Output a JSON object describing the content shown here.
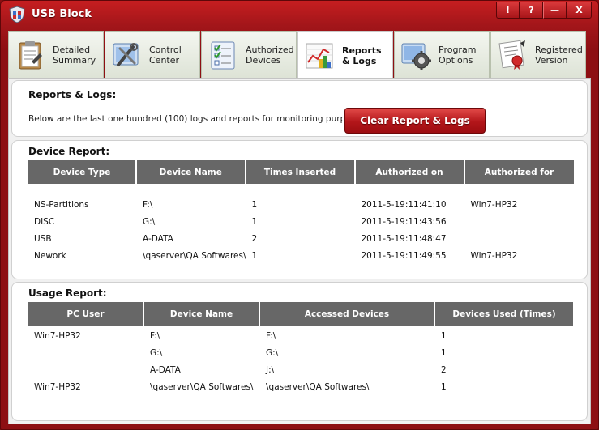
{
  "window": {
    "title": "USB Block"
  },
  "window_controls": {
    "alert": "!",
    "help": "?",
    "minimize": "—",
    "close": "X"
  },
  "tabs": [
    {
      "label": "Detailed\nSummary",
      "icon": "clipboard-icon"
    },
    {
      "label": "Control\nCenter",
      "icon": "tools-icon"
    },
    {
      "label": "Authorized\nDevices",
      "icon": "checklist-icon"
    },
    {
      "label": "Reports\n& Logs",
      "icon": "chart-icon",
      "active": true
    },
    {
      "label": "Program\nOptions",
      "icon": "gear-icon"
    },
    {
      "label": "Registered\nVersion",
      "icon": "certificate-icon"
    }
  ],
  "reports": {
    "title": "Reports & Logs:",
    "description": "Below are the last one hundred (100) logs and reports for monitoring purpose.",
    "clear_button": "Clear Report & Logs"
  },
  "device_report": {
    "title": "Device Report:",
    "columns": [
      "Device Type",
      "Device Name",
      "Times Inserted",
      "Authorized on",
      "Authorized for"
    ],
    "rows": [
      [
        "NS-Partitions",
        "F:\\",
        "1",
        "2011-5-19:11:41:10",
        "Win7-HP32"
      ],
      [
        "DISC",
        "G:\\",
        "1",
        "2011-5-19:11:43:56",
        ""
      ],
      [
        "USB",
        "A-DATA",
        "2",
        "2011-5-19:11:48:47",
        ""
      ],
      [
        "Nework",
        "\\qaserver\\QA Softwares\\",
        "1",
        "2011-5-19:11:49:55",
        "Win7-HP32"
      ]
    ]
  },
  "usage_report": {
    "title": "Usage Report:",
    "columns": [
      "PC User",
      "Device Name",
      "Accessed Devices",
      "Devices Used (Times)"
    ],
    "rows": [
      [
        "Win7-HP32",
        "F:\\",
        "F:\\",
        "1"
      ],
      [
        "",
        "G:\\",
        "G:\\",
        "1"
      ],
      [
        "",
        "A-DATA",
        "J:\\",
        "2"
      ],
      [
        "Win7-HP32",
        "\\qaserver\\QA Softwares\\",
        "\\qaserver\\QA Softwares\\",
        "1"
      ]
    ]
  },
  "colors": {
    "title_bar": "#a3161a",
    "table_header": "#676767",
    "button_red": "#b3161a"
  }
}
